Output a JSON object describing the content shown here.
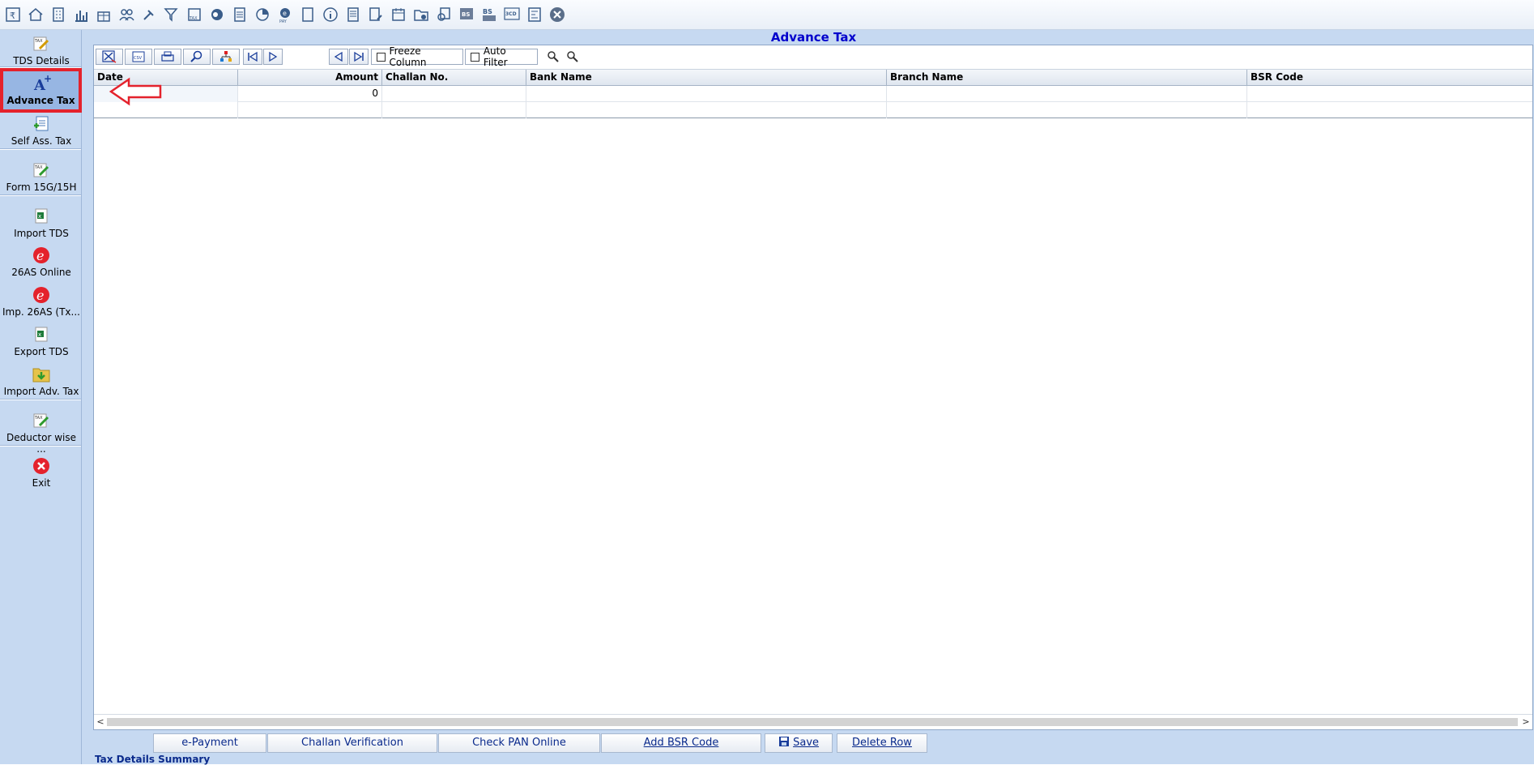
{
  "toolbar": {
    "icons": [
      "rupee-book-icon",
      "home-icon",
      "building-icon",
      "bar-chart-icon",
      "gift-icon",
      "users-icon",
      "gavel-icon",
      "filter-icon",
      "tax-icon",
      "pie-toggle-icon",
      "calculator-icon",
      "pie-chart-icon",
      "epay-icon",
      "book-icon",
      "info-icon",
      "report-icon",
      "edit-doc-icon",
      "calendar-icon",
      "folder-add-icon",
      "copy-doc-icon",
      "bs-icon",
      "bs-sch-icon",
      "3cd-icon",
      "form-icon",
      "close-circle-icon"
    ]
  },
  "sidebar": {
    "items": [
      {
        "label": "TDS Details"
      },
      {
        "label": "Advance Tax"
      },
      {
        "label": "Self Ass. Tax"
      },
      {
        "label": "Form 15G/15H"
      },
      {
        "label": "Import TDS"
      },
      {
        "label": "26AS Online"
      },
      {
        "label": "Imp. 26AS (Tx..."
      },
      {
        "label": "Export TDS"
      },
      {
        "label": "Import Adv. Tax"
      },
      {
        "label": "Deductor wise ..."
      },
      {
        "label": "Exit"
      }
    ]
  },
  "main": {
    "title": "Advance Tax"
  },
  "grid_toolbar": {
    "freeze_column": "Freeze Column",
    "auto_filter": "Auto Filter"
  },
  "grid": {
    "columns": [
      "Date",
      "Amount",
      "Challan No.",
      "Bank Name",
      "Branch Name",
      "BSR Code"
    ],
    "rows": [
      [
        "",
        "0",
        "",
        "",
        "",
        ""
      ],
      [
        "",
        "",
        "",
        "",
        "",
        ""
      ]
    ]
  },
  "bottom_buttons": {
    "epayment": "e-Payment",
    "challan_verification": "Challan Verification",
    "check_pan": "Check PAN Online",
    "add_bsr": "Add BSR Code",
    "save": "Save",
    "delete_row": "Delete Row"
  },
  "summary_label": "Tax Details Summary",
  "colors": {
    "accent_blue": "#0000cc",
    "sidebar_bg": "#c6d9f1",
    "highlight_red": "#e4222c"
  }
}
